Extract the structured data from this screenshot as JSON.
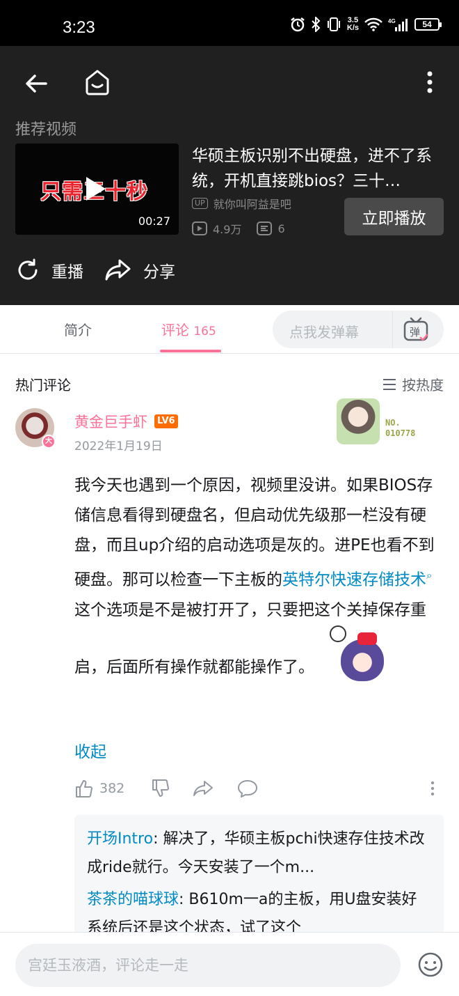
{
  "status_bar": {
    "time": "3:23",
    "net_speed_value": "3.5",
    "net_speed_unit": "K/s",
    "battery": "54",
    "icons": [
      "alarm-icon",
      "bluetooth-icon",
      "vibrate-icon",
      "wifi-icon",
      "signal-4g-icon",
      "battery-icon"
    ]
  },
  "player": {
    "section_title": "推荐视频",
    "video": {
      "thumbnail_text": "只需三十秒",
      "duration": "00:27",
      "title": "华硕主板识别不出硬盘，进不了系统，开机直接跳bios？三十…",
      "up_tag": "UP",
      "uploader": "就你叫阿益是吧",
      "views": "4.9万",
      "danmaku_count": "6"
    },
    "play_now": "立即播放",
    "replay": "重播",
    "share": "分享"
  },
  "tabs": {
    "intro": "简介",
    "comments": "评论",
    "comments_count": "165",
    "danmaku_placeholder": "点我发弹幕",
    "danmaku_icon_label": "弹"
  },
  "comments_section": {
    "title": "热门评论",
    "sort_label": "按热度"
  },
  "comment": {
    "username": "黄金巨手虾",
    "level": "LV6",
    "avatar_badge": "大",
    "date": "2022年1月19日",
    "fan_badge_label": "NO.",
    "fan_badge_number": "010778",
    "text_part1": "我今天也遇到一个原因，视频里没讲。如果BIOS存储信息看得到硬盘名，但启动优先级那一栏没有硬盘，而且up介绍的启动选项是灰的。进PE也看不到硬盘。那可以检查一下主板的",
    "link_text": "英特尔快速存储技术",
    "text_part2": "这个选项是不是被打开了，只要把这个关掉保存重启，后面所有操作就都能操作了。",
    "collapse": "收起",
    "likes": "382"
  },
  "replies": [
    {
      "user": "开场Intro",
      "text": "解决了，华硕主板pchi快速存住技术改成ride就行。今天安装了一个m..."
    },
    {
      "user": "茶茶的喵球球",
      "text": "B610m一a的主板，用U盘安装好系统后还是这个状态，试了这个"
    }
  ],
  "bottom_input": {
    "placeholder": "宫廷玉液酒，评论走一走"
  },
  "colors": {
    "accent_pink": "#fb7299",
    "link_blue": "#008ac5",
    "dark_panel": "#202020"
  }
}
